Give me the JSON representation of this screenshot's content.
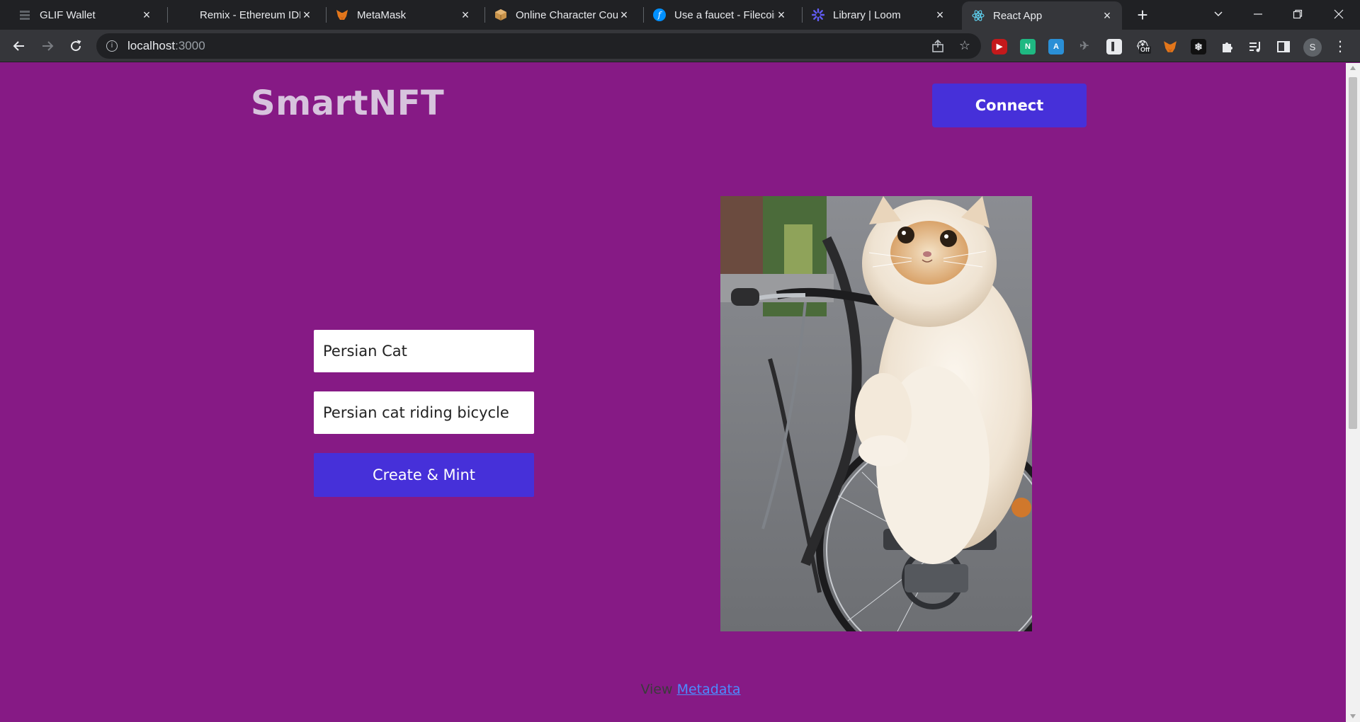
{
  "browser": {
    "tabs": [
      {
        "title": "GLIF Wallet",
        "icon": "glif-icon",
        "active": false
      },
      {
        "title": "Remix - Ethereum IDE",
        "icon": "remix-icon",
        "active": false
      },
      {
        "title": "MetaMask",
        "icon": "metamask-fox-icon",
        "active": false
      },
      {
        "title": "Online Character Cou",
        "icon": "box-icon",
        "active": false
      },
      {
        "title": "Use a faucet - Filecoin",
        "icon": "filecoin-icon",
        "active": false
      },
      {
        "title": "Library | Loom",
        "icon": "loom-icon",
        "active": false
      },
      {
        "title": "React App",
        "icon": "react-icon",
        "active": true
      }
    ],
    "url_host": "localhost",
    "url_port": ":3000",
    "profile_initial": "S",
    "extension_off_badge": "Off"
  },
  "app": {
    "brand": "SmartNFT",
    "connect_label": "Connect",
    "name_value": "Persian Cat",
    "description_value": "Persian cat riding bicycle",
    "mint_label": "Create & Mint",
    "footer_prefix": "View ",
    "footer_link": "Metadata"
  },
  "colors": {
    "page_bg": "#861a85",
    "accent": "#4630d9",
    "brand_text": "#d7c3dd",
    "link": "#4c8bff"
  }
}
